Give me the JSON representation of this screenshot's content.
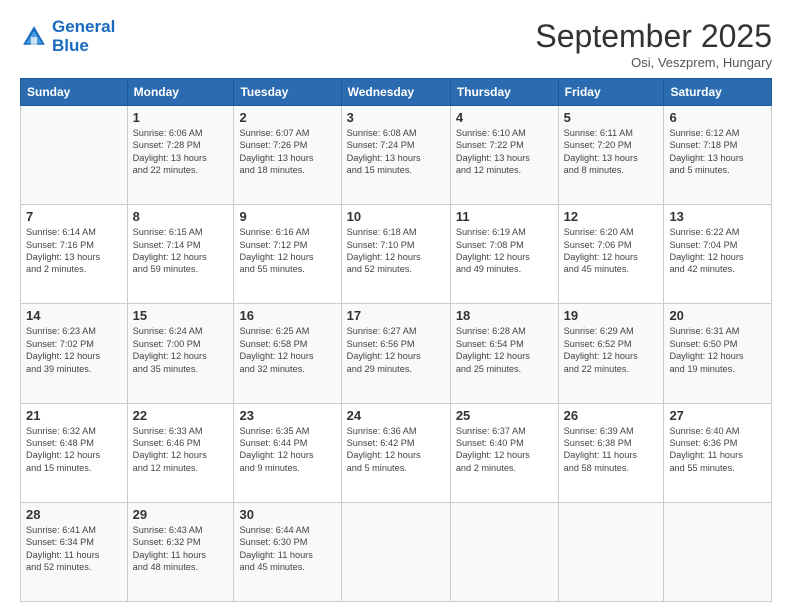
{
  "header": {
    "logo_line1": "General",
    "logo_line2": "Blue",
    "month": "September 2025",
    "location": "Osi, Veszprem, Hungary"
  },
  "weekdays": [
    "Sunday",
    "Monday",
    "Tuesday",
    "Wednesday",
    "Thursday",
    "Friday",
    "Saturday"
  ],
  "weeks": [
    [
      {
        "day": "",
        "info": ""
      },
      {
        "day": "1",
        "info": "Sunrise: 6:06 AM\nSunset: 7:28 PM\nDaylight: 13 hours\nand 22 minutes."
      },
      {
        "day": "2",
        "info": "Sunrise: 6:07 AM\nSunset: 7:26 PM\nDaylight: 13 hours\nand 18 minutes."
      },
      {
        "day": "3",
        "info": "Sunrise: 6:08 AM\nSunset: 7:24 PM\nDaylight: 13 hours\nand 15 minutes."
      },
      {
        "day": "4",
        "info": "Sunrise: 6:10 AM\nSunset: 7:22 PM\nDaylight: 13 hours\nand 12 minutes."
      },
      {
        "day": "5",
        "info": "Sunrise: 6:11 AM\nSunset: 7:20 PM\nDaylight: 13 hours\nand 8 minutes."
      },
      {
        "day": "6",
        "info": "Sunrise: 6:12 AM\nSunset: 7:18 PM\nDaylight: 13 hours\nand 5 minutes."
      }
    ],
    [
      {
        "day": "7",
        "info": "Sunrise: 6:14 AM\nSunset: 7:16 PM\nDaylight: 13 hours\nand 2 minutes."
      },
      {
        "day": "8",
        "info": "Sunrise: 6:15 AM\nSunset: 7:14 PM\nDaylight: 12 hours\nand 59 minutes."
      },
      {
        "day": "9",
        "info": "Sunrise: 6:16 AM\nSunset: 7:12 PM\nDaylight: 12 hours\nand 55 minutes."
      },
      {
        "day": "10",
        "info": "Sunrise: 6:18 AM\nSunset: 7:10 PM\nDaylight: 12 hours\nand 52 minutes."
      },
      {
        "day": "11",
        "info": "Sunrise: 6:19 AM\nSunset: 7:08 PM\nDaylight: 12 hours\nand 49 minutes."
      },
      {
        "day": "12",
        "info": "Sunrise: 6:20 AM\nSunset: 7:06 PM\nDaylight: 12 hours\nand 45 minutes."
      },
      {
        "day": "13",
        "info": "Sunrise: 6:22 AM\nSunset: 7:04 PM\nDaylight: 12 hours\nand 42 minutes."
      }
    ],
    [
      {
        "day": "14",
        "info": "Sunrise: 6:23 AM\nSunset: 7:02 PM\nDaylight: 12 hours\nand 39 minutes."
      },
      {
        "day": "15",
        "info": "Sunrise: 6:24 AM\nSunset: 7:00 PM\nDaylight: 12 hours\nand 35 minutes."
      },
      {
        "day": "16",
        "info": "Sunrise: 6:25 AM\nSunset: 6:58 PM\nDaylight: 12 hours\nand 32 minutes."
      },
      {
        "day": "17",
        "info": "Sunrise: 6:27 AM\nSunset: 6:56 PM\nDaylight: 12 hours\nand 29 minutes."
      },
      {
        "day": "18",
        "info": "Sunrise: 6:28 AM\nSunset: 6:54 PM\nDaylight: 12 hours\nand 25 minutes."
      },
      {
        "day": "19",
        "info": "Sunrise: 6:29 AM\nSunset: 6:52 PM\nDaylight: 12 hours\nand 22 minutes."
      },
      {
        "day": "20",
        "info": "Sunrise: 6:31 AM\nSunset: 6:50 PM\nDaylight: 12 hours\nand 19 minutes."
      }
    ],
    [
      {
        "day": "21",
        "info": "Sunrise: 6:32 AM\nSunset: 6:48 PM\nDaylight: 12 hours\nand 15 minutes."
      },
      {
        "day": "22",
        "info": "Sunrise: 6:33 AM\nSunset: 6:46 PM\nDaylight: 12 hours\nand 12 minutes."
      },
      {
        "day": "23",
        "info": "Sunrise: 6:35 AM\nSunset: 6:44 PM\nDaylight: 12 hours\nand 9 minutes."
      },
      {
        "day": "24",
        "info": "Sunrise: 6:36 AM\nSunset: 6:42 PM\nDaylight: 12 hours\nand 5 minutes."
      },
      {
        "day": "25",
        "info": "Sunrise: 6:37 AM\nSunset: 6:40 PM\nDaylight: 12 hours\nand 2 minutes."
      },
      {
        "day": "26",
        "info": "Sunrise: 6:39 AM\nSunset: 6:38 PM\nDaylight: 11 hours\nand 58 minutes."
      },
      {
        "day": "27",
        "info": "Sunrise: 6:40 AM\nSunset: 6:36 PM\nDaylight: 11 hours\nand 55 minutes."
      }
    ],
    [
      {
        "day": "28",
        "info": "Sunrise: 6:41 AM\nSunset: 6:34 PM\nDaylight: 11 hours\nand 52 minutes."
      },
      {
        "day": "29",
        "info": "Sunrise: 6:43 AM\nSunset: 6:32 PM\nDaylight: 11 hours\nand 48 minutes."
      },
      {
        "day": "30",
        "info": "Sunrise: 6:44 AM\nSunset: 6:30 PM\nDaylight: 11 hours\nand 45 minutes."
      },
      {
        "day": "",
        "info": ""
      },
      {
        "day": "",
        "info": ""
      },
      {
        "day": "",
        "info": ""
      },
      {
        "day": "",
        "info": ""
      }
    ]
  ]
}
